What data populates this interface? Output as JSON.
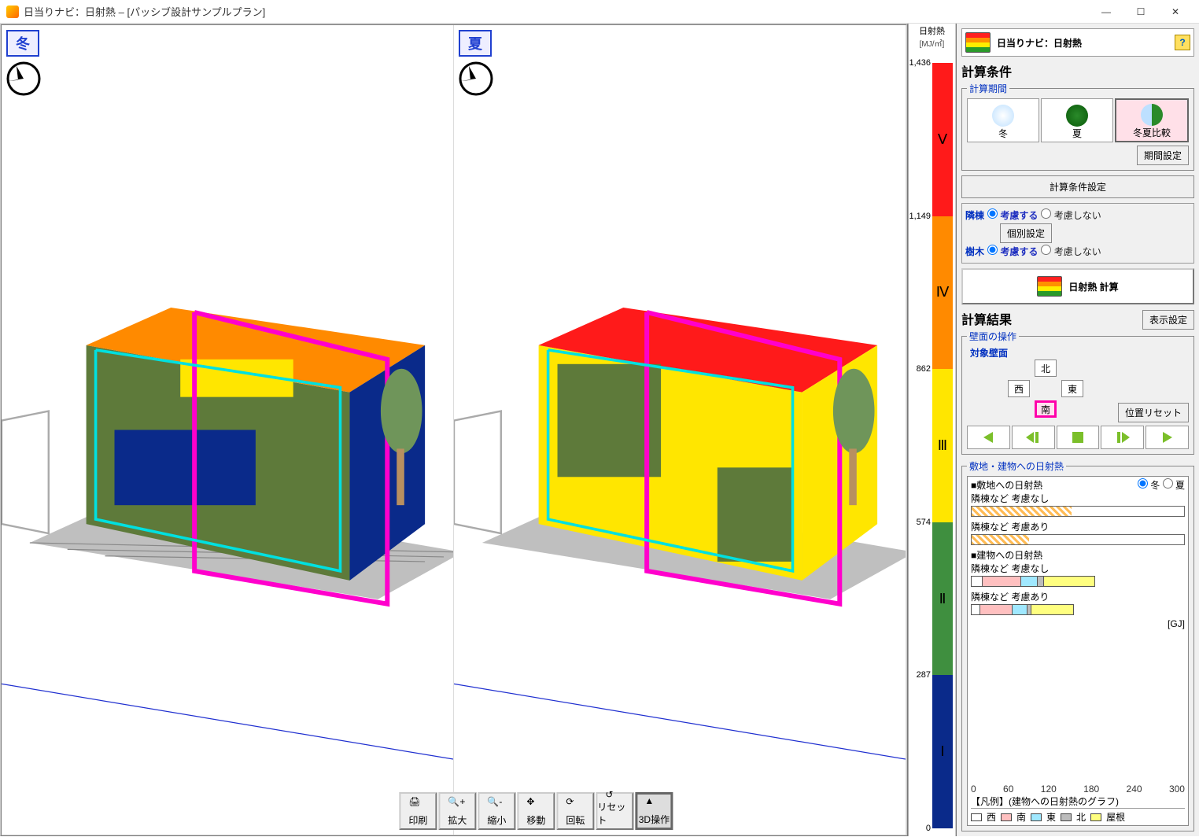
{
  "window": {
    "title": "日当りナビ：日射熱  –  [パッシブ設計サンプルプラン]"
  },
  "views": {
    "left": "冬",
    "right": "夏"
  },
  "scale": {
    "title": "日射熱",
    "unit": "[MJ/㎡]",
    "levels": [
      "Ⅴ",
      "Ⅳ",
      "Ⅲ",
      "Ⅱ",
      "Ⅰ"
    ],
    "ticks": [
      "1,436",
      "1,149",
      "862",
      "574",
      "287",
      "0"
    ],
    "colors": [
      "#ff1a1a",
      "#ff8a00",
      "#ffe600",
      "#3f8f3f",
      "#0a2a8a"
    ]
  },
  "panel": {
    "title": "日当りナビ：日射熱",
    "calc_title": "計算条件",
    "period_legend": "計算期間",
    "periods": {
      "winter": "冬",
      "summer": "夏",
      "compare": "冬夏比較"
    },
    "period_setting_btn": "期間設定",
    "calc_setting_btn": "計算条件設定",
    "adjacent": {
      "label": "隣棟",
      "yes": "考慮する",
      "no": "考慮しない",
      "indiv": "個別設定"
    },
    "trees": {
      "label": "樹木",
      "yes": "考慮する",
      "no": "考慮しない"
    },
    "calc_btn": "日射熱 計算",
    "result_title": "計算結果",
    "display_setting_btn": "表示設定",
    "wall_legend": "壁面の操作",
    "wall_target": "対象壁面",
    "dirs": {
      "n": "北",
      "s": "南",
      "e": "東",
      "w": "西"
    },
    "pos_reset": "位置リセット",
    "graph_legend": "敷地・建物への日射熱",
    "season_radio": {
      "winter": "冬",
      "summer": "夏"
    },
    "graph": {
      "site_title": "■敷地への日射熱",
      "site_no": "隣棟など 考慮なし",
      "site_yes": "隣棟など 考慮あり",
      "bld_title": "■建物への日射熱",
      "bld_no": "隣棟など 考慮なし",
      "bld_yes": "隣棟など 考慮あり",
      "unit": "[GJ]",
      "axis": [
        "0",
        "60",
        "120",
        "180",
        "240",
        "300"
      ],
      "legend_title": "【凡例】(建物への日射熱のグラフ)",
      "legend": {
        "w": "西",
        "s": "南",
        "e": "東",
        "n": "北",
        "r": "屋根"
      }
    }
  },
  "toolbar3d": {
    "print": "印刷",
    "zoomin": "拡大",
    "zoomout": "縮小",
    "pan": "移動",
    "rotate": "回転",
    "reset": "リセット",
    "op3d": "3D操作"
  },
  "chart_data": {
    "type": "bar",
    "unit": "GJ",
    "site_solar": {
      "no_adjacent": 140,
      "with_adjacent": 80
    },
    "building_solar_stacked": {
      "order": [
        "west",
        "south",
        "east",
        "north",
        "roof"
      ],
      "no_adjacent": {
        "west": 15,
        "south": 55,
        "east": 25,
        "north": 8,
        "roof": 70
      },
      "with_adjacent": {
        "west": 12,
        "south": 45,
        "east": 20,
        "north": 7,
        "roof": 60
      }
    },
    "xaxis": [
      0,
      60,
      120,
      180,
      240,
      300
    ]
  }
}
